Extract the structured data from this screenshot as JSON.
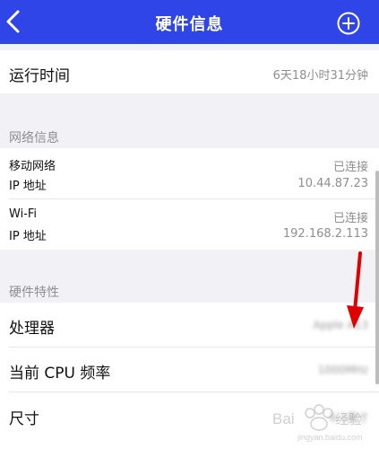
{
  "header": {
    "title": "硬件信息",
    "back_icon": "chevron-left-icon",
    "add_icon": "plus-circle-icon",
    "bg_color": "#2f45e8"
  },
  "uptime": {
    "label": "运行时间",
    "value": "6天18小时31分钟"
  },
  "network": {
    "header": "网络信息",
    "mobile": {
      "label": "移动网络",
      "status": "已连接",
      "ip_label": "IP 地址",
      "ip_value": "10.44.87.23"
    },
    "wifi": {
      "label": "Wi-Fi",
      "status": "已连接",
      "ip_label": "IP 地址",
      "ip_value": "192.168.2.113"
    }
  },
  "hardware": {
    "header": "硬件特性",
    "processor_label": "处理器",
    "processor_value": "Apple A13",
    "cpu_freq_label": "当前 CPU 频率",
    "cpu_freq_value": "1000MHz",
    "size_label": "尺寸",
    "size_value": "6.1英寸"
  },
  "annotation": {
    "arrow_color": "#e00000",
    "watermark": "Baidu经验"
  }
}
